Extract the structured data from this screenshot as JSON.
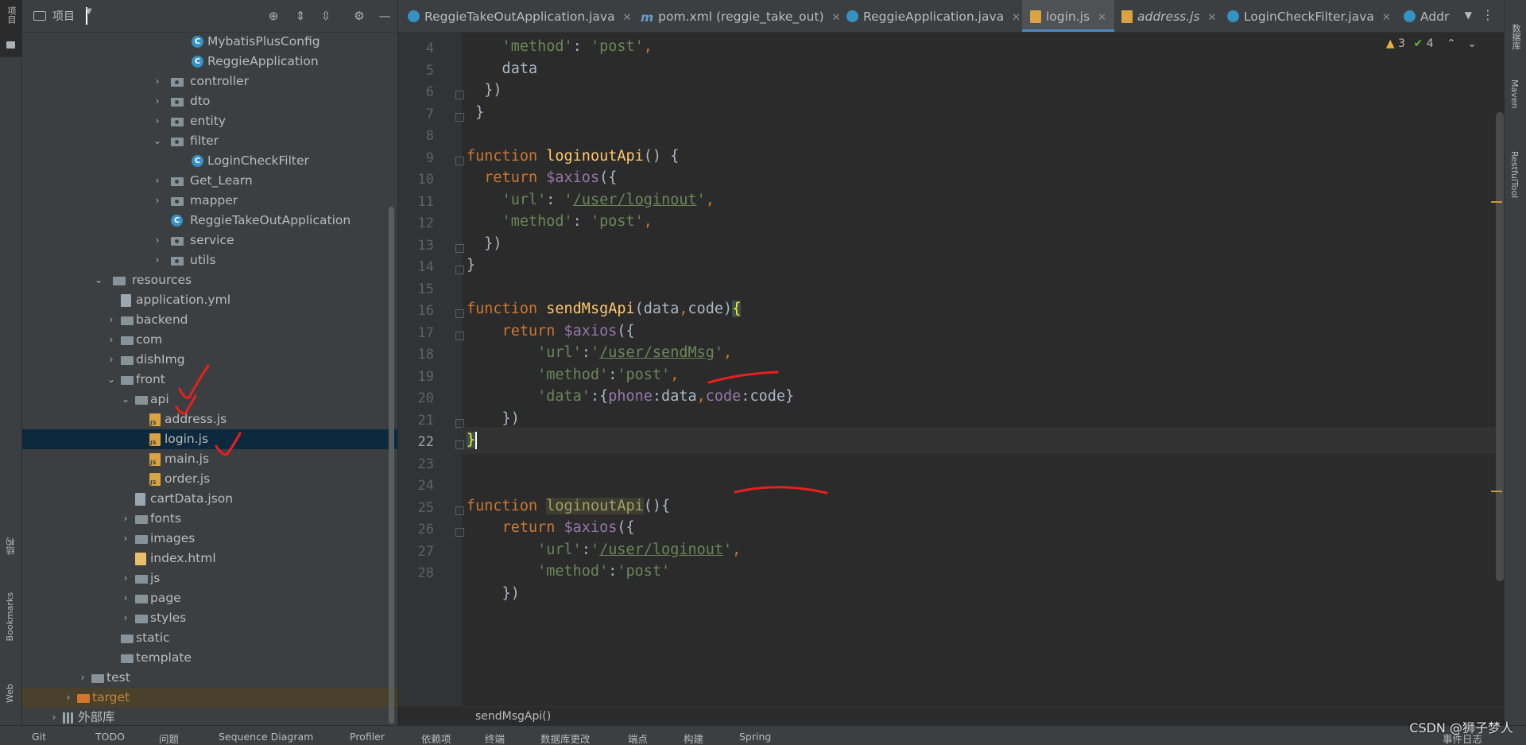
{
  "left_strip": {
    "project_label": "项目",
    "structure_label": "结构",
    "bookmarks_label": "Bookmarks",
    "web_label": "Web"
  },
  "right_strip": {
    "database_label": "数据库",
    "maven_label": "Maven",
    "restful_label": "RestfulTool"
  },
  "project_panel": {
    "title": "项目",
    "tree": [
      {
        "label": "MybatisPlusConfig",
        "icon": "class"
      },
      {
        "label": "ReggieApplication",
        "icon": "class"
      },
      {
        "label": "controller",
        "icon": "package"
      },
      {
        "label": "dto",
        "icon": "package"
      },
      {
        "label": "entity",
        "icon": "package"
      },
      {
        "label": "filter",
        "icon": "package"
      },
      {
        "label": "LoginCheckFilter",
        "icon": "class"
      },
      {
        "label": "Get_Learn",
        "icon": "package"
      },
      {
        "label": "mapper",
        "icon": "package"
      },
      {
        "label": "ReggieTakeOutApplication",
        "icon": "spring-boot-class"
      },
      {
        "label": "service",
        "icon": "package"
      },
      {
        "label": "utils",
        "icon": "package"
      },
      {
        "label": "resources",
        "icon": "resources-folder"
      },
      {
        "label": "application.yml",
        "icon": "yml"
      },
      {
        "label": "backend",
        "icon": "folder"
      },
      {
        "label": "com",
        "icon": "folder"
      },
      {
        "label": "dishImg",
        "icon": "folder"
      },
      {
        "label": "front",
        "icon": "folder"
      },
      {
        "label": "api",
        "icon": "folder"
      },
      {
        "label": "address.js",
        "icon": "js"
      },
      {
        "label": "login.js",
        "icon": "js"
      },
      {
        "label": "main.js",
        "icon": "js"
      },
      {
        "label": "order.js",
        "icon": "js"
      },
      {
        "label": "cartData.json",
        "icon": "json"
      },
      {
        "label": "fonts",
        "icon": "folder"
      },
      {
        "label": "images",
        "icon": "folder"
      },
      {
        "label": "index.html",
        "icon": "html"
      },
      {
        "label": "js",
        "icon": "folder"
      },
      {
        "label": "page",
        "icon": "folder"
      },
      {
        "label": "styles",
        "icon": "folder"
      },
      {
        "label": "static",
        "icon": "folder"
      },
      {
        "label": "template",
        "icon": "folder"
      },
      {
        "label": "test",
        "icon": "folder"
      },
      {
        "label": "target",
        "icon": "excluded-folder"
      },
      {
        "label": "外部库",
        "icon": "library"
      }
    ]
  },
  "tabs": [
    {
      "label": "ReggieTakeOutApplication.java"
    },
    {
      "label": "pom.xml (reggie_take_out)"
    },
    {
      "label": "ReggieApplication.java"
    },
    {
      "label": "login.js"
    },
    {
      "label": "address.js"
    },
    {
      "label": "LoginCheckFilter.java"
    },
    {
      "label": "Addr"
    }
  ],
  "inspections": {
    "warnings": "3",
    "ok": "4"
  },
  "editor": {
    "current_line": 22,
    "line_numbers": [
      "4",
      "5",
      "6",
      "7",
      "8",
      "9",
      "10",
      "11",
      "12",
      "13",
      "14",
      "15",
      "16",
      "17",
      "18",
      "19",
      "20",
      "21",
      "22",
      "23",
      "24",
      "25",
      "26",
      "27",
      "28"
    ],
    "lines": [
      "    'method': 'post',",
      "    data",
      "  })",
      " }",
      "",
      "function loginoutApi() {",
      "  return $axios({",
      "    'url': '/user/loginout',",
      "    'method': 'post',",
      "  })",
      "}",
      "",
      "function sendMsgApi(data,code){",
      "    return $axios({",
      "        'url':'/user/sendMsg',",
      "        'method':'post',",
      "        'data':{phone:data,code:code}",
      "    })",
      "}",
      "",
      "",
      "function loginoutApi(){",
      "    return $axios({",
      "        'url':'/user/loginout',",
      "        'method':'post'",
      "    })"
    ]
  },
  "breadcrumb": "sendMsgApi()",
  "bottom_bar": {
    "items": [
      "Git",
      "TODO",
      "问题",
      "Sequence Diagram",
      "Profiler",
      "依赖项",
      "终端",
      "数据库更改",
      "端点",
      "构建",
      "Spring",
      "事件日志"
    ]
  },
  "watermark": "CSDN @狮子梦人",
  "colors": {
    "keyword": "#cc7832",
    "function": "#ffc66d",
    "string": "#6a8759",
    "variable": "#9876aa",
    "annotation_red": "#e8201e"
  }
}
